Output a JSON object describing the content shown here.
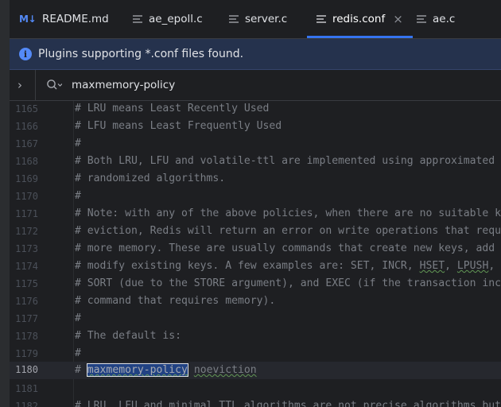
{
  "tabs": [
    {
      "label": "README.md",
      "icon": "markdown-icon",
      "active": false
    },
    {
      "label": "ae_epoll.c",
      "icon": "text-file-icon",
      "active": false
    },
    {
      "label": "server.c",
      "icon": "text-file-icon",
      "active": false
    },
    {
      "label": "redis.conf",
      "icon": "text-file-icon",
      "active": true
    },
    {
      "label": "ae.c",
      "icon": "text-file-icon",
      "active": false
    }
  ],
  "notification": {
    "text": "Plugins supporting *.conf files found."
  },
  "search": {
    "query": "maxmemory-policy"
  },
  "lines": [
    {
      "num": "1165",
      "text": "# LRU means Least Recently Used"
    },
    {
      "num": "1166",
      "text": "# LFU means Least Frequently Used"
    },
    {
      "num": "1167",
      "text": "#"
    },
    {
      "num": "1168",
      "text": "# Both LRU, LFU and volatile-ttl are implemented using approximated"
    },
    {
      "num": "1169",
      "text": "# randomized algorithms."
    },
    {
      "num": "1170",
      "text": "#"
    },
    {
      "num": "1171",
      "text": "# Note: with any of the above policies, when there are no suitable keys for"
    },
    {
      "num": "1172",
      "text": "# eviction, Redis will return an error on write operations that require"
    },
    {
      "num": "1173",
      "text": "# more memory. These are usually commands that create new keys, add data or"
    },
    {
      "num": "1174",
      "pre": "# modify existing keys. A few examples are: SET, INCR, ",
      "typo1": "HSET",
      "mid": ", ",
      "typo2": "LPUSH",
      "post": ", SUNIONSTORE,"
    },
    {
      "num": "1175",
      "text": "# SORT (due to the STORE argument), and EXEC (if the transaction includes any"
    },
    {
      "num": "1176",
      "text": "# command that requires memory)."
    },
    {
      "num": "1177",
      "text": "#"
    },
    {
      "num": "1178",
      "text": "# The default is:"
    },
    {
      "num": "1179",
      "text": "#"
    },
    {
      "num": "1180",
      "pre": "# ",
      "match": "maxmemory-policy",
      "mid": " ",
      "typo2": "noeviction",
      "current": true
    },
    {
      "num": "1181",
      "text": ""
    },
    {
      "num": "1182",
      "text": "# LRU, LFU and minimal TTL algorithms are not precise algorithms but"
    }
  ],
  "colors": {
    "accent": "#3574f0",
    "info": "#548af7",
    "notification_bg": "#25324d"
  }
}
